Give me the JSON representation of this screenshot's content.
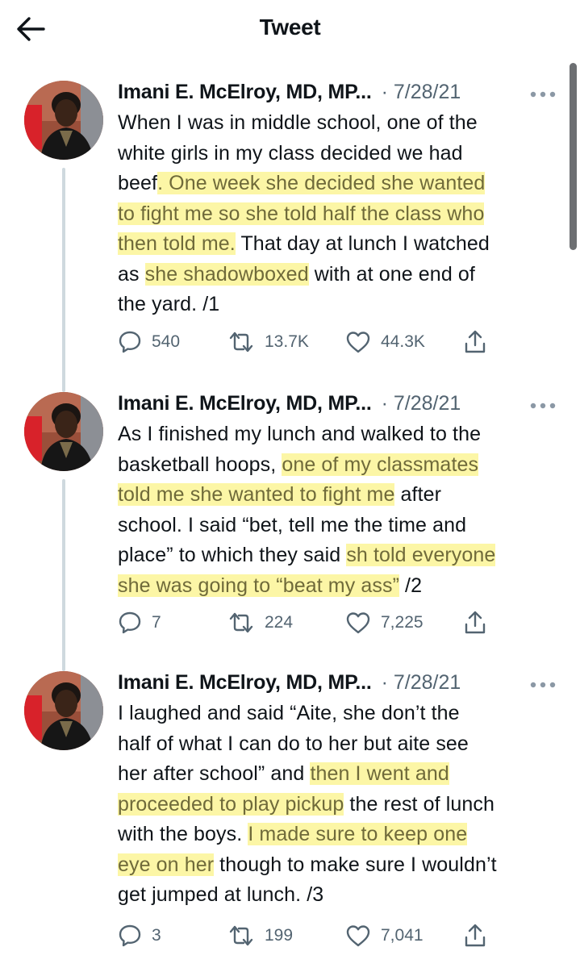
{
  "header": {
    "title": "Tweet",
    "back_icon": "arrow-left-icon"
  },
  "tweets": [
    {
      "author": "Imani E. McElroy, MD, MP...",
      "date": "· 7/28/21",
      "lines": [
        [
          {
            "t": "When I was in middle school, one of the",
            "h": false
          }
        ],
        [
          {
            "t": "white girls in my class decided we had",
            "h": false
          }
        ],
        [
          {
            "t": "beef",
            "h": false
          },
          {
            "t": ". One week she decided she wanted",
            "h": true
          }
        ],
        [
          {
            "t": "to fight me so she told half the class who",
            "h": true
          }
        ],
        [
          {
            "t": "then told me.",
            "h": true
          },
          {
            "t": " That day at lunch I watched",
            "h": false
          }
        ],
        [
          {
            "t": "as ",
            "h": false
          },
          {
            "t": "she shadowboxed",
            "h": true
          },
          {
            "t": " with at one end of",
            "h": false
          }
        ],
        [
          {
            "t": "the yard. /1",
            "h": false
          }
        ]
      ],
      "replies": "540",
      "retweets": "13.7K",
      "likes": "44.3K"
    },
    {
      "author": "Imani E. McElroy, MD, MP...",
      "date": "· 7/28/21",
      "lines": [
        [
          {
            "t": "As I finished my lunch and walked to the",
            "h": false
          }
        ],
        [
          {
            "t": "basketball hoops, ",
            "h": false
          },
          {
            "t": "one of my classmates",
            "h": true
          }
        ],
        [
          {
            "t": "told me she wanted to fight me",
            "h": true
          },
          {
            "t": " after",
            "h": false
          }
        ],
        [
          {
            "t": "school. I said “bet, tell me the time and",
            "h": false
          }
        ],
        [
          {
            "t": "place” to which they said ",
            "h": false
          },
          {
            "t": "sh told everyone",
            "h": true
          }
        ],
        [
          {
            "t": "she was going to “beat my ass”",
            "h": true
          },
          {
            "t": " /2",
            "h": false
          }
        ]
      ],
      "replies": "7",
      "retweets": "224",
      "likes": "7,225"
    },
    {
      "author": "Imani E. McElroy, MD, MP...",
      "date": "· 7/28/21",
      "lines": [
        [
          {
            "t": "I laughed and said “Aite, she don’t the",
            "h": false
          }
        ],
        [
          {
            "t": "half of what I can do to her but aite see",
            "h": false
          }
        ],
        [
          {
            "t": "her after school” and ",
            "h": false
          },
          {
            "t": "then I went and",
            "h": true
          }
        ],
        [
          {
            "t": "proceeded to play pickup",
            "h": true
          },
          {
            "t": " the rest of lunch",
            "h": false
          }
        ],
        [
          {
            "t": "with the boys. ",
            "h": false
          },
          {
            "t": "I made sure to keep one",
            "h": true
          }
        ],
        [
          {
            "t": "eye on her",
            "h": true
          },
          {
            "t": " though to make sure I wouldn’t",
            "h": false
          }
        ],
        [
          {
            "t": "get jumped at lunch. /3",
            "h": false
          }
        ]
      ],
      "replies": "3",
      "retweets": "199",
      "likes": "7,041"
    }
  ],
  "colors": {
    "highlight": "#fcf596",
    "secondary_text": "#536471",
    "thread_line": "#cfd9de"
  }
}
